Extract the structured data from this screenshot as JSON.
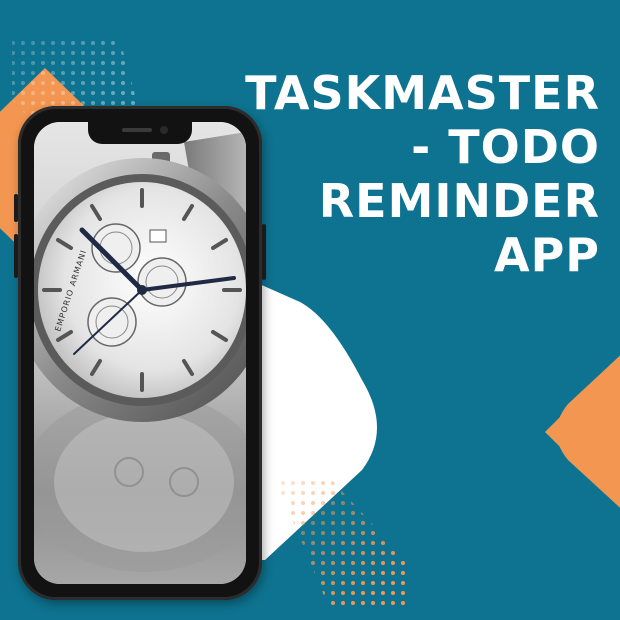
{
  "title_lines": [
    "TASKMASTER",
    "- TODO",
    "REMINDER",
    "APP"
  ],
  "watch_brand": "EMPORIO ARMANI",
  "colors": {
    "background": "#0e7390",
    "accent": "#f39651",
    "panel": "#ffffff",
    "title_text": "#ffffff"
  }
}
